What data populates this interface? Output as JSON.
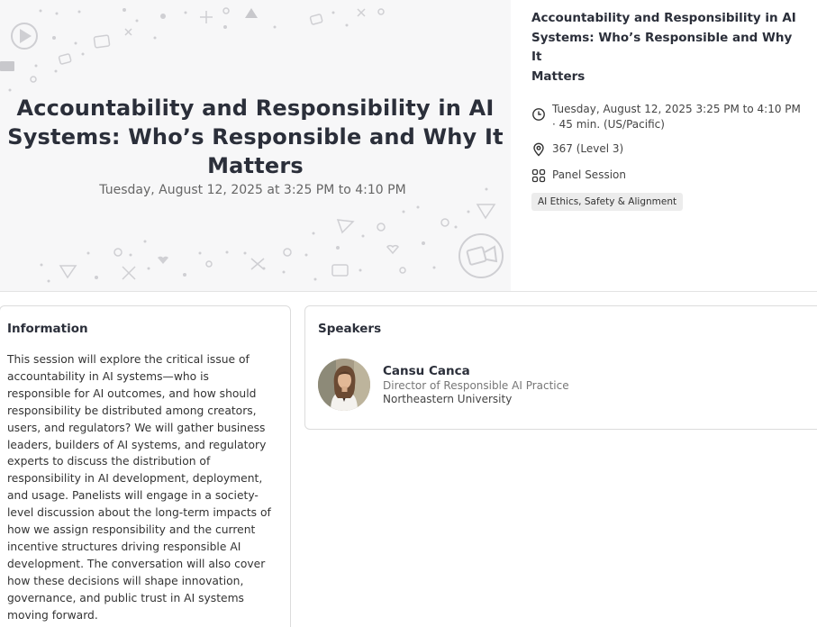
{
  "session": {
    "title": "Accountability and Responsibility in AI Systems: Who’s Responsible and Why It Matters",
    "hero_title_line1": "Accountability and Responsibility in AI",
    "hero_title_line2": "Systems: Who’s Responsible and Why It",
    "hero_title_line3": "Matters",
    "hero_datetime": "Tuesday, August 12, 2025 at 3:25 PM to 4:10 PM",
    "side_title_line1": "Accountability and Responsibility in AI",
    "side_title_line2": "Systems: Who’s Responsible and Why It",
    "side_title_line3": "Matters",
    "time_line1": "Tuesday, August 12, 2025 3:25 PM to 4:10 PM",
    "time_line2": "· 45 min. (US/Pacific)",
    "location": "367 (Level 3)",
    "type": "Panel Session",
    "tag": "AI Ethics, Safety & Alignment"
  },
  "icons": {
    "time": "clock-icon",
    "location": "map-pin-icon",
    "type": "grid-icon",
    "hero_play": "play-icon",
    "hero_camera": "video-camera-icon"
  },
  "information": {
    "heading": "Information",
    "lines": [
      "This session will explore the critical issue of",
      "accountability in AI systems—who is",
      "responsible for AI outcomes, and how should",
      "responsibility be distributed among creators,",
      "users, and regulators? We will gather business",
      "leaders, builders of AI systems, and regulatory",
      "experts to discuss the distribution of",
      "responsibility in AI development, deployment,",
      "and usage. Panelists will engage in a society-",
      "level discussion about the long-term impacts of",
      "how we assign responsibility and the current",
      "incentive structures driving responsible AI",
      "development. The conversation will also cover",
      "how these decisions will shape innovation,",
      "governance, and public trust in AI systems",
      "moving forward."
    ]
  },
  "speakers": {
    "heading": "Speakers",
    "items": [
      {
        "name": "Cansu Canca",
        "role": "Director of Responsible AI Practice",
        "org": "Northeastern University"
      }
    ]
  },
  "colors": {
    "hero_bg": "#f7f7f8",
    "title_text": "#2b2f3a",
    "tag_bg": "#ececec",
    "border": "#dcdcdc"
  }
}
